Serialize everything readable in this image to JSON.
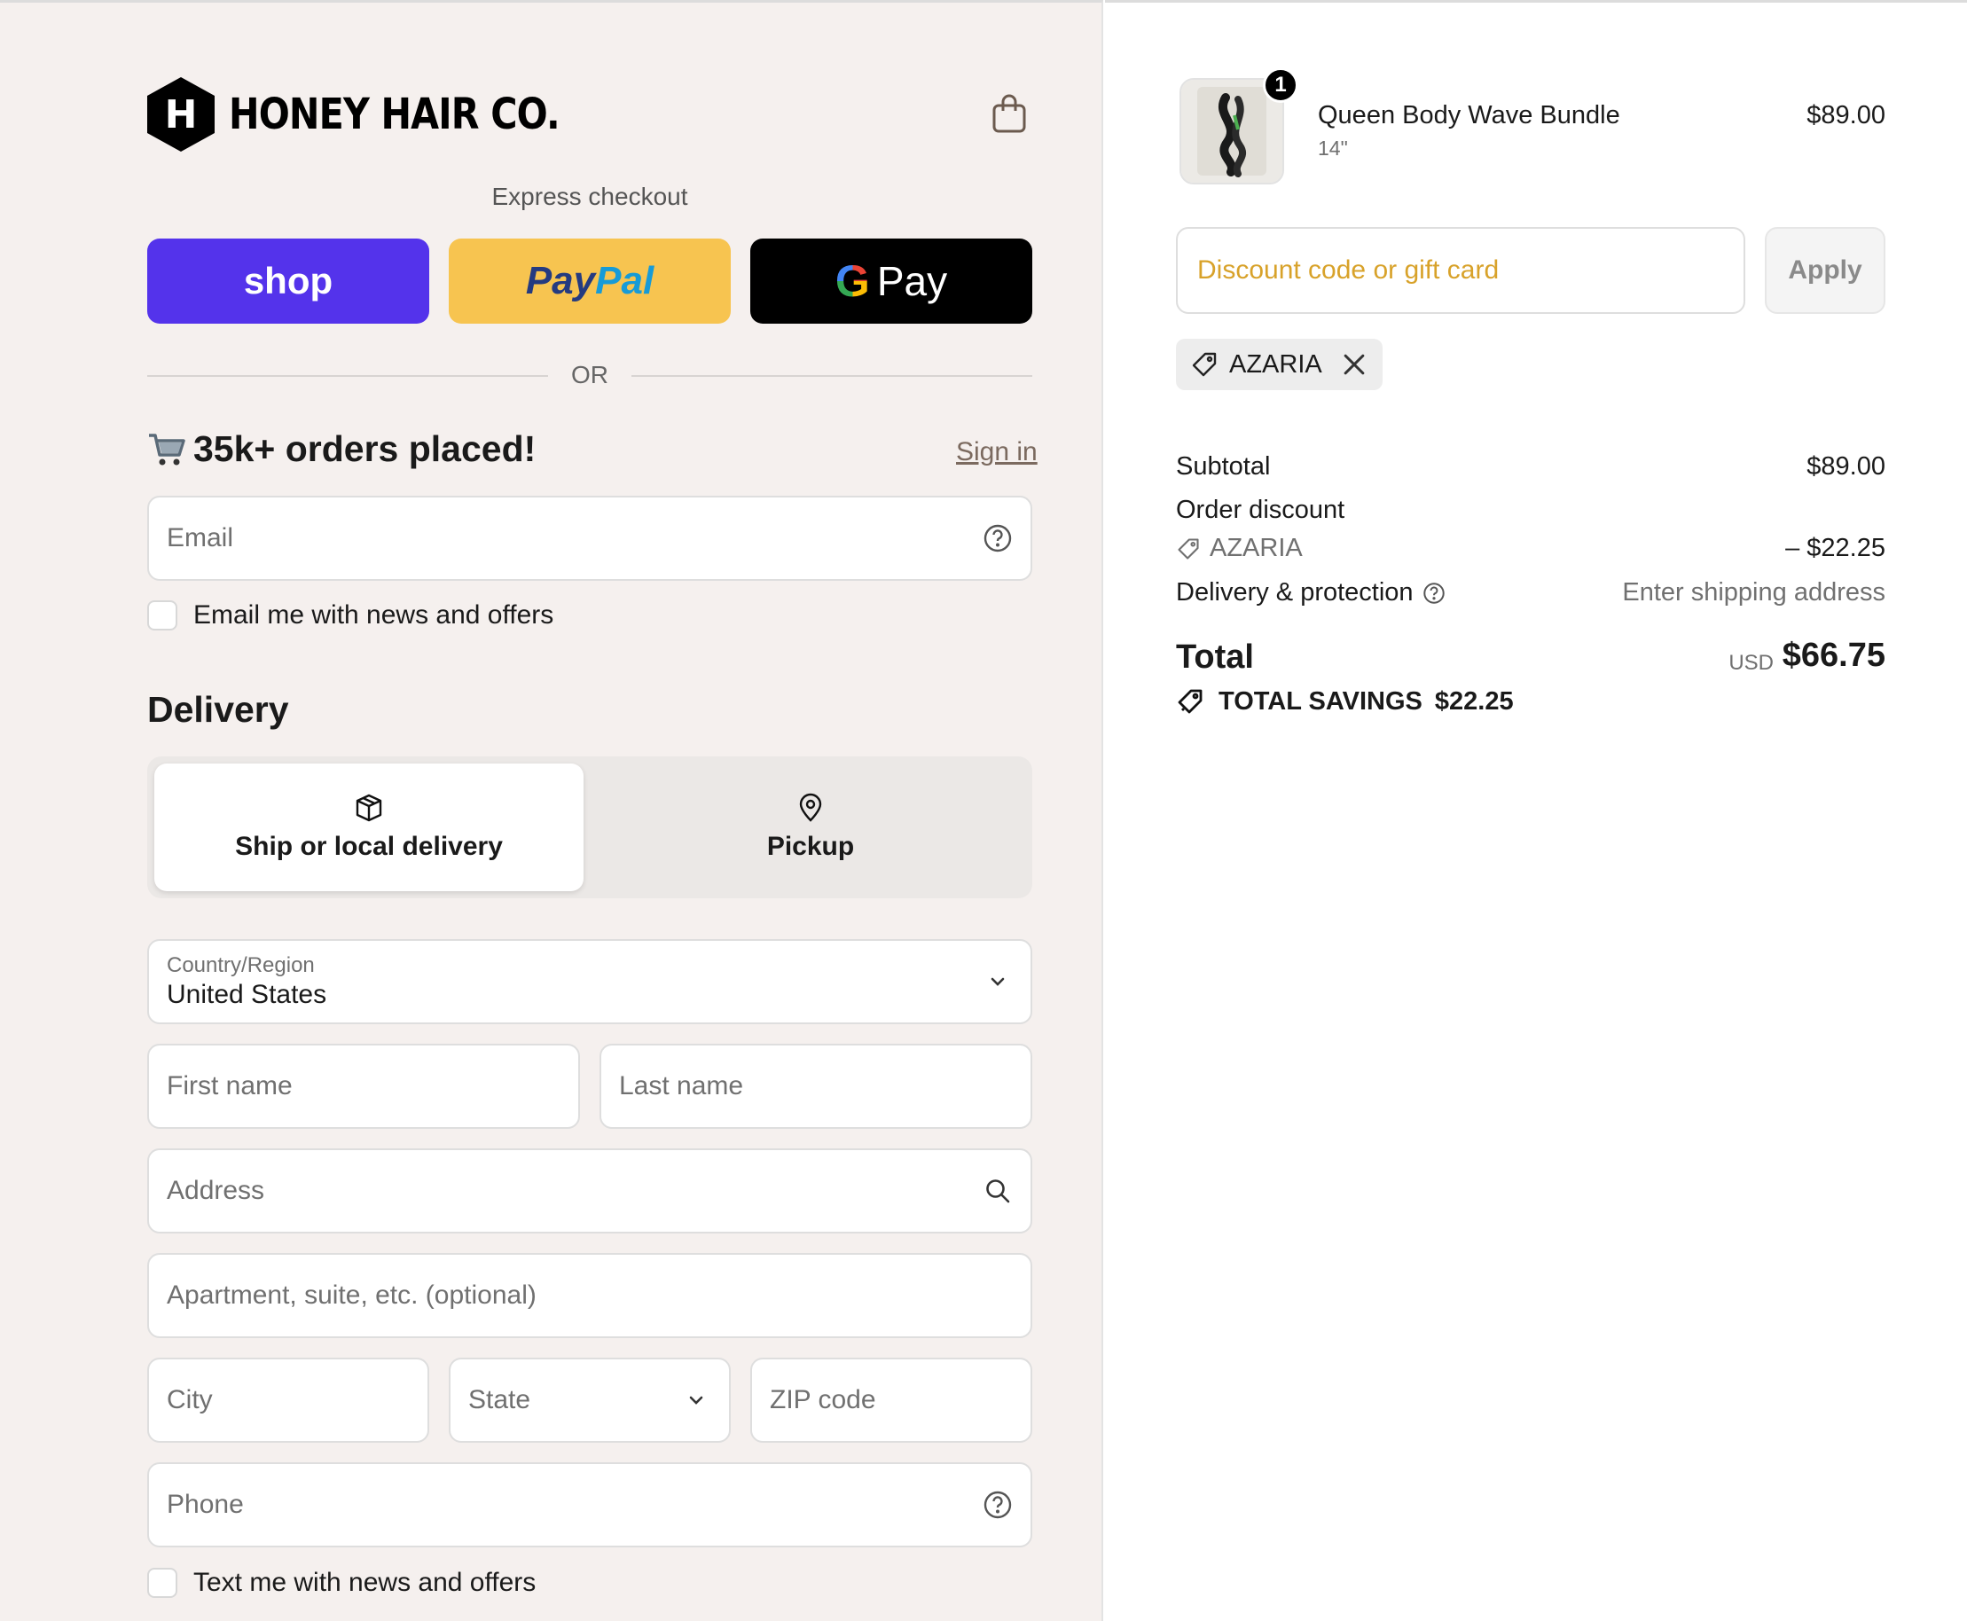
{
  "brand": {
    "name": "HONEY HAIR CO.",
    "logo_letter": "H"
  },
  "express": {
    "label": "Express checkout",
    "shop_label": "shop",
    "paypal_part1": "Pay",
    "paypal_part2": "Pal",
    "gpay_g": "G",
    "gpay_label": "Pay",
    "or_label": "OR"
  },
  "contact": {
    "title": "35k+ orders placed!",
    "sign_in": "Sign in",
    "email_placeholder": "Email",
    "email_optin": "Email me with news and offers"
  },
  "delivery": {
    "title": "Delivery",
    "option_ship": "Ship or local delivery",
    "option_pickup": "Pickup",
    "country_label": "Country/Region",
    "country_value": "United States",
    "first_name": "First name",
    "last_name": "Last name",
    "address": "Address",
    "apartment": "Apartment, suite, etc. (optional)",
    "city": "City",
    "state": "State",
    "zip": "ZIP code",
    "phone": "Phone",
    "sms_optin": "Text me with news and offers"
  },
  "cart": {
    "quantity": "1",
    "product_name": "Queen Body Wave Bundle",
    "variant": "14\"",
    "price": "$89.00",
    "discount_placeholder": "Discount code or gift card",
    "apply_label": "Apply",
    "applied_code": "AZARIA"
  },
  "summary": {
    "subtotal_label": "Subtotal",
    "subtotal_value": "$89.00",
    "discount_label": "Order discount",
    "discount_code": "AZARIA",
    "discount_value": "– $22.25",
    "delivery_label": "Delivery & protection",
    "delivery_value": "Enter shipping address",
    "total_label": "Total",
    "currency": "USD",
    "total_value": "$66.75",
    "savings_label": "TOTAL SAVINGS",
    "savings_value": "$22.25"
  },
  "colors": {
    "shop": "#5433eb",
    "paypal": "#f7c450",
    "discount_text": "#d8a22a",
    "left_bg": "#f5f0ee"
  }
}
